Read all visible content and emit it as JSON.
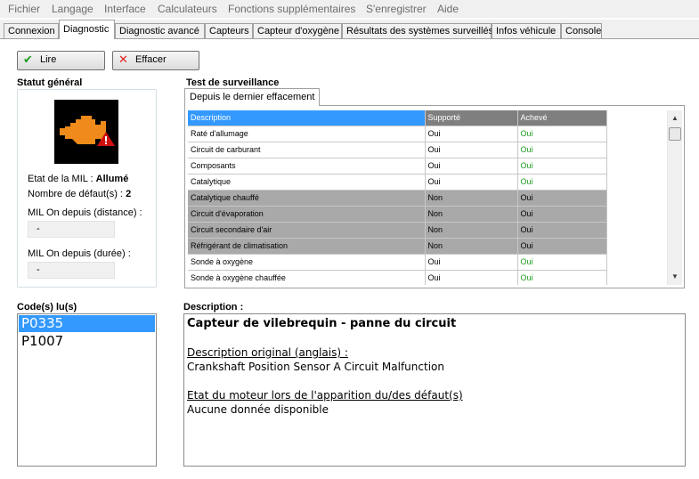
{
  "menu": [
    "Fichier",
    "Langage",
    "Interface",
    "Calculateurs",
    "Fonctions supplémentaires",
    "S'enregistrer",
    "Aide"
  ],
  "tabs": [
    "Connexion",
    "Diagnostic",
    "Diagnostic avancé",
    "Capteurs",
    "Capteur d'oxygène",
    "Résultats des systèmes surveillés",
    "Infos véhicule",
    "Console"
  ],
  "active_tab": "Diagnostic",
  "buttons": {
    "read": "Lire",
    "clear": "Effacer"
  },
  "status": {
    "title": "Statut général",
    "mil_state_label": "Etat de la MIL : ",
    "mil_state_value": "Allumé",
    "fault_count_label": "Nombre de défaut(s) : ",
    "fault_count_value": "2",
    "mil_distance_label": "MIL On depuis (distance) :",
    "mil_distance_value": "-",
    "mil_duration_label": "MIL On depuis (durée) :",
    "mil_duration_value": "-"
  },
  "monitoring": {
    "title": "Test de surveillance",
    "subtab": "Depuis le dernier effacement",
    "columns": [
      "Description",
      "Supporté",
      "Achevé"
    ],
    "rows": [
      [
        "Raté d'allumage",
        "Oui",
        "Oui"
      ],
      [
        "Circuit de carburant",
        "Oui",
        "Oui"
      ],
      [
        "Composants",
        "Oui",
        "Oui"
      ],
      [
        "Catalytique",
        "Oui",
        "Oui"
      ],
      [
        "Catalytique chauffé",
        "Non",
        "Oui"
      ],
      [
        "Circuit d'évaporation",
        "Non",
        "Oui"
      ],
      [
        "Circuit secondaire d'air",
        "Non",
        "Oui"
      ],
      [
        "Réfrigérant de climatisation",
        "Non",
        "Oui"
      ],
      [
        "Sonde à oxygène",
        "Oui",
        "Oui"
      ],
      [
        "Sonde à oxygène chauffée",
        "Oui",
        "Oui"
      ]
    ]
  },
  "codes": {
    "title": "Code(s) lu(s)",
    "items": [
      "P0335",
      "P1007"
    ]
  },
  "description": {
    "title": "Description :",
    "heading": "Capteur de vilebrequin - panne du circuit",
    "original_label": "Description original (anglais) :",
    "original_text": "Crankshaft Position Sensor A Circuit Malfunction",
    "engine_state_label": "Etat du moteur lors de l'apparition du/des défaut(s)",
    "engine_state_text": "Aucune donnée disponible"
  },
  "colors": {
    "selection": "#3399ff",
    "check": "#1c9c1c",
    "cross": "#e02020",
    "engine": "#f08a1a",
    "warning": "#d01010"
  },
  "icons": {
    "read": "check-icon",
    "clear": "cross-icon",
    "mil": "engine-warning-icon"
  }
}
